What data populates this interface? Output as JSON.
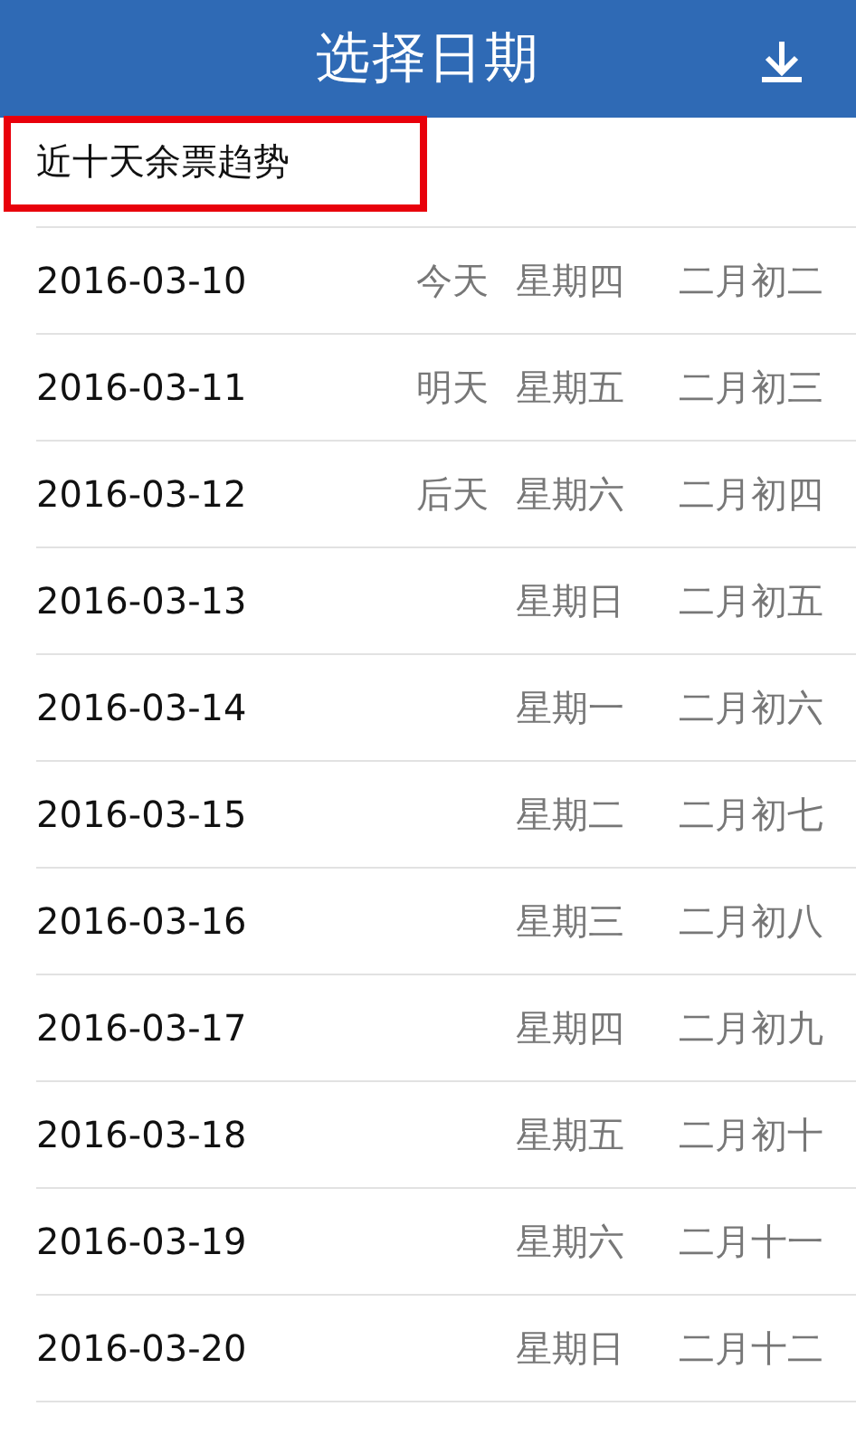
{
  "header": {
    "title": "选择日期"
  },
  "trend_link": {
    "label": "近十天余票趋势",
    "highlighted": true
  },
  "dates": [
    {
      "date": "2016-03-10",
      "relative": "今天",
      "weekday": "星期四",
      "lunar": "二月初二"
    },
    {
      "date": "2016-03-11",
      "relative": "明天",
      "weekday": "星期五",
      "lunar": "二月初三"
    },
    {
      "date": "2016-03-12",
      "relative": "后天",
      "weekday": "星期六",
      "lunar": "二月初四"
    },
    {
      "date": "2016-03-13",
      "weekday": "星期日",
      "lunar": "二月初五"
    },
    {
      "date": "2016-03-14",
      "weekday": "星期一",
      "lunar": "二月初六"
    },
    {
      "date": "2016-03-15",
      "weekday": "星期二",
      "lunar": "二月初七"
    },
    {
      "date": "2016-03-16",
      "weekday": "星期三",
      "lunar": "二月初八"
    },
    {
      "date": "2016-03-17",
      "weekday": "星期四",
      "lunar": "二月初九"
    },
    {
      "date": "2016-03-18",
      "weekday": "星期五",
      "lunar": "二月初十"
    },
    {
      "date": "2016-03-19",
      "weekday": "星期六",
      "lunar": "二月十一"
    },
    {
      "date": "2016-03-20",
      "weekday": "星期日",
      "lunar": "二月十二"
    }
  ]
}
